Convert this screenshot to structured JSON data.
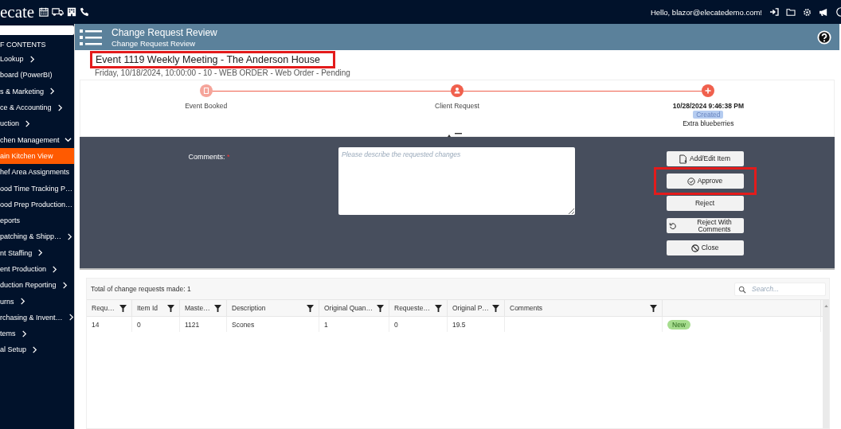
{
  "topbar": {
    "logo": "ecate",
    "greeting": "Hello, blazor@elecatedemo.com!"
  },
  "sidebar": {
    "heading": "F CONTENTS",
    "items": [
      {
        "label": "Lookup",
        "expanded": false,
        "selected": false
      },
      {
        "label": "board (PowerBI)",
        "selected": false
      },
      {
        "label": "s & Marketing",
        "expanded": false,
        "selected": false
      },
      {
        "label": "ce & Accounting",
        "expanded": false,
        "selected": false
      },
      {
        "label": "uction",
        "expanded": false,
        "selected": false
      },
      {
        "label": "chen Management",
        "expanded": true,
        "selected": false,
        "children": [
          {
            "label": "ain Kitchen View",
            "selected": true
          },
          {
            "label": "hef Area Assignments",
            "selected": false
          },
          {
            "label": "ood Time Tracking P…",
            "selected": false
          },
          {
            "label": "ood Prep Production…",
            "selected": false
          },
          {
            "label": "eports",
            "selected": false
          }
        ]
      },
      {
        "label": "patching & Shipp…",
        "expanded": false,
        "selected": false
      },
      {
        "label": "nt Staffing",
        "expanded": false,
        "selected": false
      },
      {
        "label": "ent Production",
        "expanded": false,
        "selected": false
      },
      {
        "label": "duction Reporting",
        "expanded": false,
        "selected": false
      },
      {
        "label": "urns",
        "expanded": false,
        "selected": false
      },
      {
        "label": "rchasing & Invent…",
        "expanded": false,
        "selected": false
      },
      {
        "label": "tems",
        "expanded": false,
        "selected": false
      },
      {
        "label": "al Setup",
        "expanded": false,
        "selected": false
      }
    ]
  },
  "header": {
    "title": "Change Request Review",
    "subtitle": "Change Request Review"
  },
  "event": {
    "title": "Event 1119 Weekly Meeting - The Anderson House",
    "highlighted": true,
    "details": "Friday, 10/18/2024, 10:00:00 - 10 - WEB ORDER - Web Order - Pending"
  },
  "timeline": [
    {
      "kind": "booked",
      "label": "Event Booked",
      "active": false
    },
    {
      "kind": "client",
      "label": "Client Request",
      "active": true
    },
    {
      "kind": "created",
      "label": "10/28/2024 9:46:38 PM",
      "badge": "Created",
      "note": "Extra blueberries",
      "active": true
    }
  ],
  "form": {
    "label": "Comments:",
    "required_mark": "*",
    "placeholder": "Please describe the requested changes"
  },
  "buttons": [
    {
      "kind": "edit",
      "label": "Add/Edit Item",
      "highlighted": false
    },
    {
      "kind": "approve",
      "label": "Approve",
      "highlighted": true
    },
    {
      "kind": "plain",
      "label": "Reject",
      "highlighted": false
    },
    {
      "kind": "undo",
      "label": "Reject With Comments",
      "highlighted": false
    },
    {
      "kind": "cancel",
      "label": "Close",
      "highlighted": false
    }
  ],
  "table": {
    "summary": "Total of change requests made: 1",
    "search": {
      "placeholder": "Search..."
    },
    "columns": [
      "Requ…",
      "Item Id",
      "Maste…",
      "Description",
      "Original Quan…",
      "Requeste…",
      "Original P…",
      "Comments"
    ],
    "rows": [
      {
        "cells": [
          "14",
          "0",
          "1121",
          "Scones",
          "1",
          "0",
          "19.5",
          ""
        ],
        "status": "New"
      }
    ]
  }
}
